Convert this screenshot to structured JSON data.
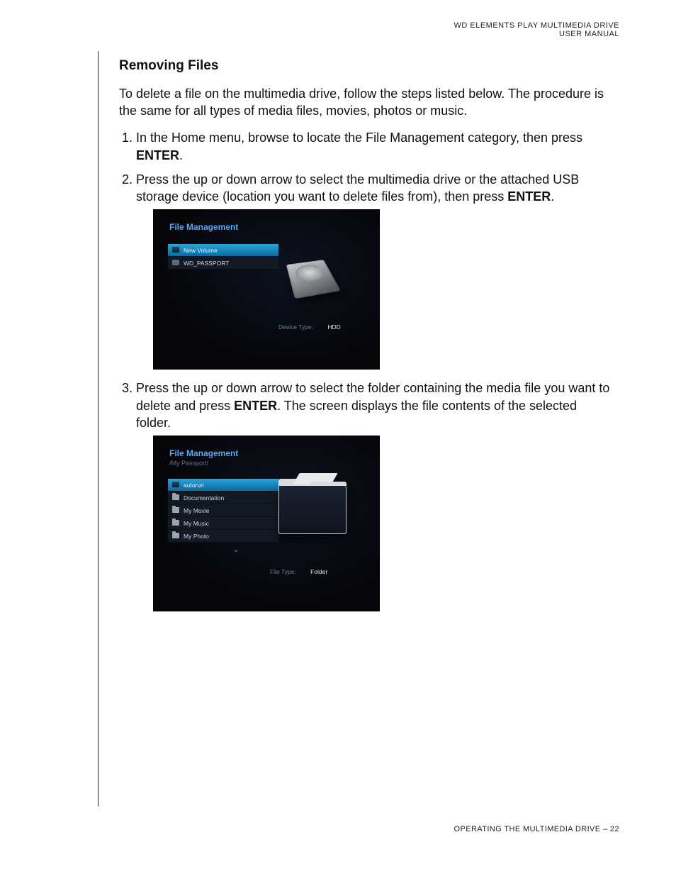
{
  "header": {
    "line1": "WD ELEMENTS PLAY MULTIMEDIA DRIVE",
    "line2": "USER MANUAL"
  },
  "section": {
    "title": "Removing Files",
    "intro": "To delete a file on the multimedia drive, follow the steps listed below. The procedure is the same for all types of media files, movies, photos or music.",
    "step1_a": "In the Home menu, browse to locate the File Management category, then press ",
    "step1_b": "ENTER",
    "step1_c": ".",
    "step2_a": "Press the up or down arrow to select the multimedia drive or the attached USB storage device (location you want to delete files from), then press ",
    "step2_b": "ENTER",
    "step2_c": ".",
    "step3_a": "Press the up or down arrow to select the folder containing the media file you want to delete and press ",
    "step3_b": "ENTER",
    "step3_c": ". The screen displays the file contents of the selected folder."
  },
  "screenshot1": {
    "title": "File Management",
    "items": [
      {
        "label": "New Volume",
        "icon": "drive",
        "selected": true
      },
      {
        "label": "WD_PASSPORT",
        "icon": "usb",
        "selected": false
      }
    ],
    "info_label": "Device Type:",
    "info_value": "HDD"
  },
  "screenshot2": {
    "title": "File Management",
    "path": "/My Passport/",
    "items": [
      {
        "label": "autorun",
        "icon": "drive",
        "selected": true
      },
      {
        "label": "Documentation",
        "icon": "folder",
        "selected": false
      },
      {
        "label": "My Movie",
        "icon": "folder",
        "selected": false
      },
      {
        "label": "My Music",
        "icon": "folder",
        "selected": false
      },
      {
        "label": "My Photo",
        "icon": "folder",
        "selected": false
      }
    ],
    "chevron": "⌄",
    "info_label": "File Type:",
    "info_value": "Folder"
  },
  "footer": {
    "label": "OPERATING THE MULTIMEDIA DRIVE",
    "sep": " – ",
    "page": "22"
  }
}
